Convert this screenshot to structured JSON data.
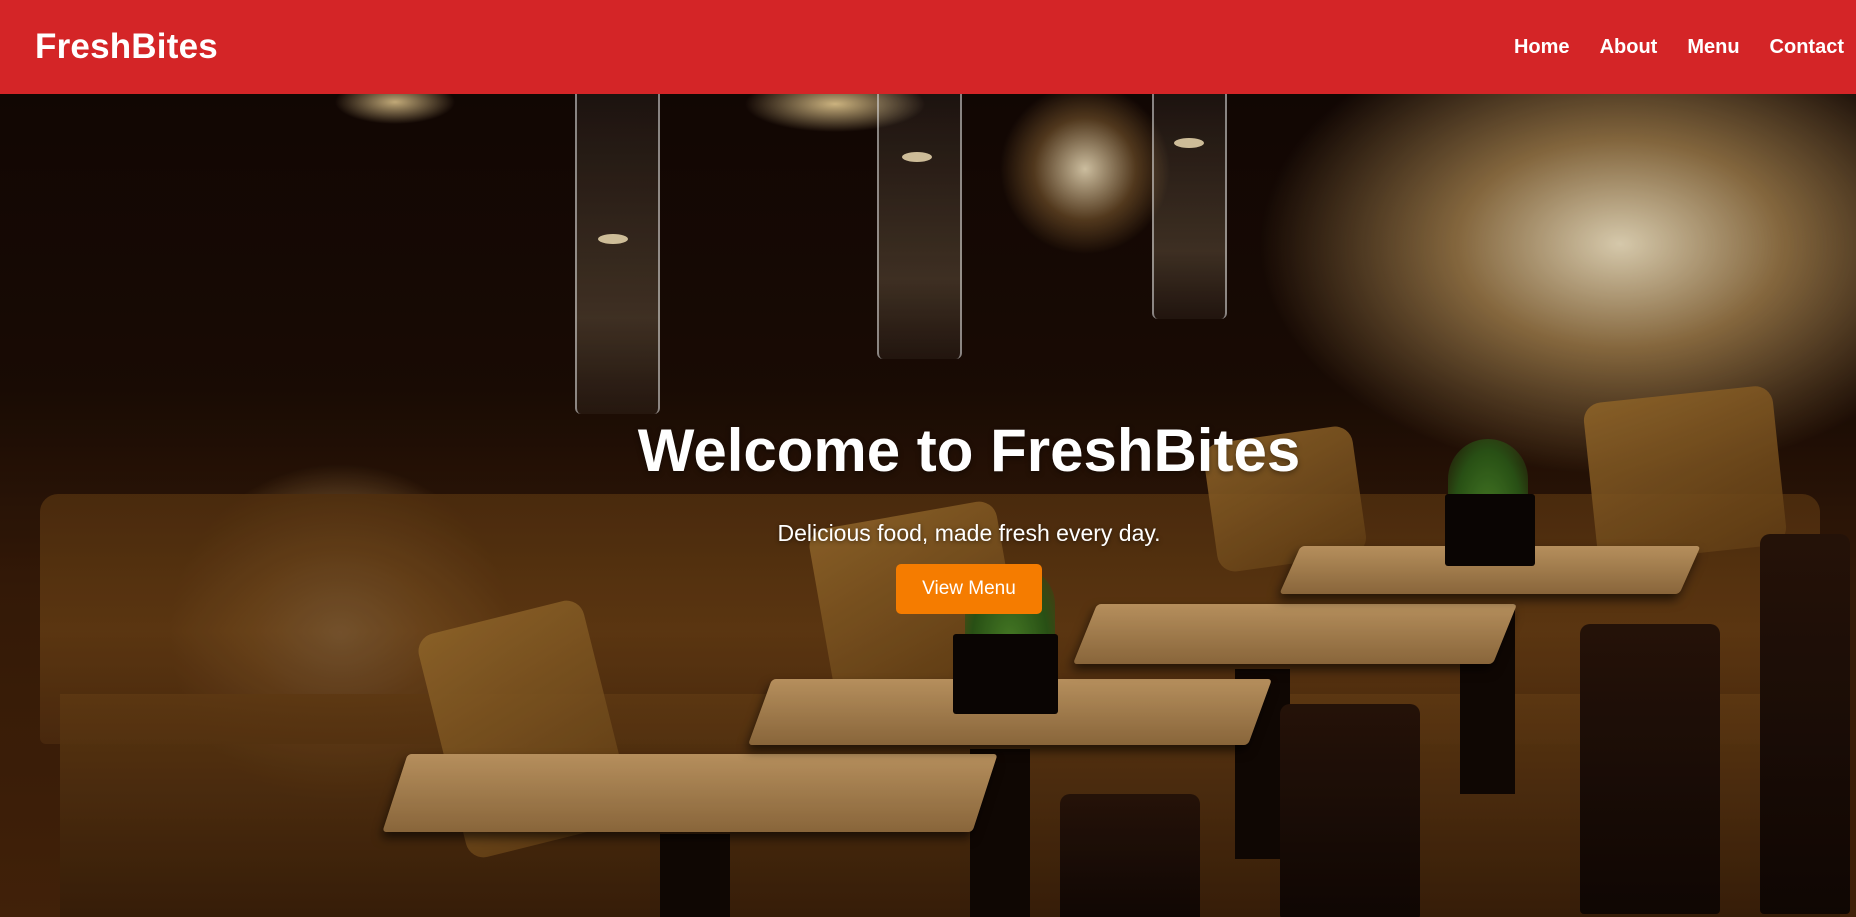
{
  "header": {
    "brand": "FreshBites",
    "nav": [
      {
        "label": "Home"
      },
      {
        "label": "About"
      },
      {
        "label": "Menu"
      },
      {
        "label": "Contact"
      }
    ]
  },
  "hero": {
    "title": "Welcome to FreshBites",
    "subtitle": "Delicious food, made fresh every day.",
    "cta_label": "View Menu"
  },
  "colors": {
    "header_bg": "#d42527",
    "cta_bg": "#f57c00",
    "text": "#ffffff"
  }
}
